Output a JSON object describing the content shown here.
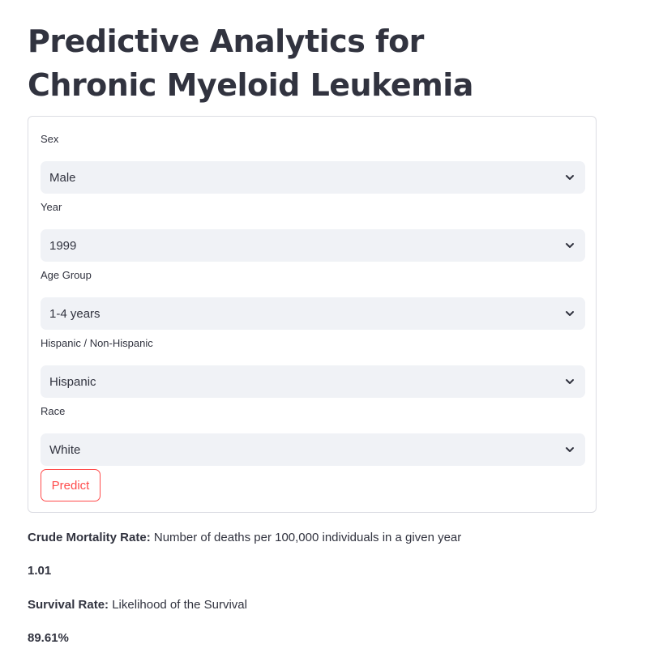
{
  "page": {
    "title": "Predictive Analytics for Chronic Myeloid Leukemia"
  },
  "form": {
    "fields": [
      {
        "label": "Sex",
        "value": "Male"
      },
      {
        "label": "Year",
        "value": "1999"
      },
      {
        "label": "Age Group",
        "value": "1-4 years"
      },
      {
        "label": "Hispanic / Non-Hispanic",
        "value": "Hispanic"
      },
      {
        "label": "Race",
        "value": "White"
      }
    ],
    "submit_label": "Predict"
  },
  "results": {
    "crude_mortality": {
      "label": "Crude Mortality Rate:",
      "description": " Number of deaths per 100,000 individuals in a given year",
      "value": "1.01"
    },
    "survival": {
      "label": "Survival Rate:",
      "description": " Likelihood of the Survival",
      "value": "89.61%"
    }
  },
  "colors": {
    "accent": "#ff4b4b",
    "select_bg": "#f0f2f6",
    "text": "#31333f",
    "border": "#dcdde3"
  },
  "icons": {
    "select_chevron": "chevron-down-icon"
  }
}
